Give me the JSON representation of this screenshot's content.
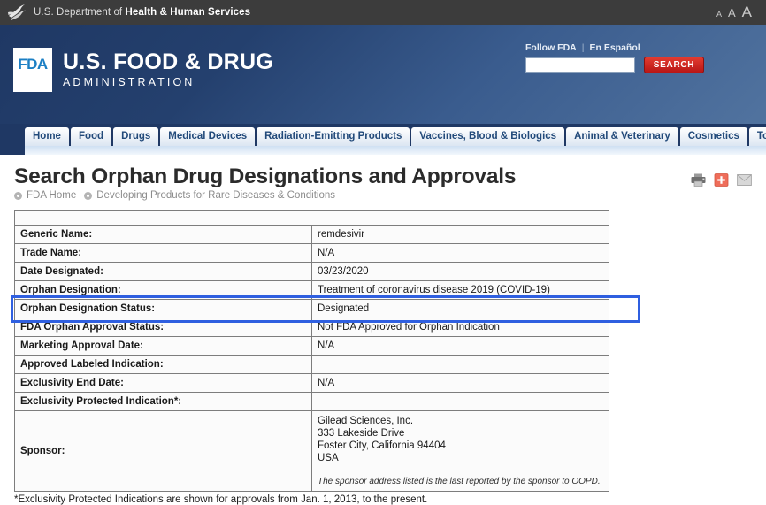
{
  "hhs_bar": {
    "seal_icon": "hhs-seal-icon",
    "text_plain": "U.S. Department of ",
    "text_bold": "Health & Human Services",
    "font_size_small": "A",
    "font_size_medium": "A",
    "font_size_large": "A"
  },
  "masthead": {
    "logo_text": "FDA",
    "title_line1": "U.S. FOOD & DRUG",
    "title_line2": "ADMINISTRATION",
    "follow_link": "Follow FDA",
    "separator": "|",
    "espanol_link": "En Español",
    "search_value": "",
    "search_placeholder": "",
    "search_button": "SEARCH"
  },
  "nav": {
    "tabs": [
      {
        "label": "Home"
      },
      {
        "label": "Food"
      },
      {
        "label": "Drugs"
      },
      {
        "label": "Medical Devices"
      },
      {
        "label": "Radiation-Emitting Products"
      },
      {
        "label": "Vaccines, Blood & Biologics"
      },
      {
        "label": "Animal & Veterinary"
      },
      {
        "label": "Cosmetics"
      },
      {
        "label": "Tobacco Products"
      }
    ]
  },
  "page": {
    "title": "Search Orphan Drug Designations and Approvals",
    "breadcrumb": [
      {
        "label": "FDA Home"
      },
      {
        "label": "Developing Products for Rare Diseases & Conditions"
      }
    ],
    "tools": [
      {
        "name": "print-icon"
      },
      {
        "name": "share-plus-icon"
      },
      {
        "name": "email-icon"
      }
    ]
  },
  "table": {
    "rows": [
      {
        "label": "",
        "value": "",
        "spacer": true
      },
      {
        "label": "Generic Name:",
        "value": "remdesivir"
      },
      {
        "label": "Trade Name:",
        "value": "N/A"
      },
      {
        "label": "Date Designated:",
        "value": "03/23/2020"
      },
      {
        "label": "Orphan Designation:",
        "value": "Treatment of coronavirus disease 2019 (COVID-19)"
      },
      {
        "label": "Orphan Designation Status:",
        "value": "Designated",
        "highlighted": true
      },
      {
        "label": "FDA Orphan Approval Status:",
        "value": "Not FDA Approved for Orphan Indication"
      },
      {
        "label": "Marketing Approval Date:",
        "value": "N/A"
      },
      {
        "label": "Approved Labeled Indication:",
        "value": ""
      },
      {
        "label": "Exclusivity End Date:",
        "value": "N/A",
        "indent": true
      },
      {
        "label": "Exclusivity Protected Indication*:",
        "value": ""
      }
    ],
    "sponsor": {
      "label": "Sponsor:",
      "lines": [
        "Gilead Sciences, Inc.",
        "333 Lakeside Drive",
        "Foster City, California 94404",
        "USA"
      ],
      "note": "The sponsor address listed is the last reported by the sponsor to OOPD."
    },
    "highlight_color": "#2f5fe0"
  },
  "footnote": "*Exclusivity Protected Indications are shown for approvals from Jan. 1, 2013, to the present."
}
